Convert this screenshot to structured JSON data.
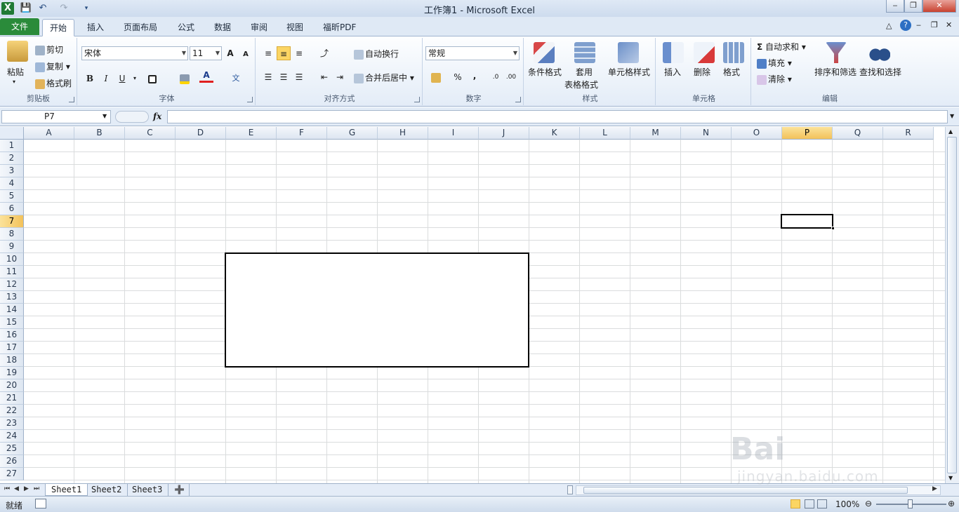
{
  "window": {
    "title": "工作簿1 - Microsoft Excel"
  },
  "qat": {
    "icons": [
      "excel-logo-icon",
      "save-icon",
      "undo-icon",
      "redo-icon",
      "customize-qat-icon"
    ]
  },
  "tabs": [
    "文件",
    "开始",
    "插入",
    "页面布局",
    "公式",
    "数据",
    "审阅",
    "视图",
    "福昕PDF"
  ],
  "ribbon": {
    "clipboard": {
      "paste": "粘贴",
      "cut": "剪切",
      "copy": "复制",
      "format_painter": "格式刷",
      "label": "剪贴板"
    },
    "font": {
      "name": "宋体",
      "size": "11",
      "bold": "B",
      "italic": "I",
      "underline": "U",
      "label": "字体",
      "grow": "A",
      "shrink": "A"
    },
    "alignment": {
      "wrap": "自动换行",
      "merge": "合并后居中",
      "label": "对齐方式"
    },
    "number": {
      "format": "常规",
      "percent": "%",
      "comma": ",",
      "label": "数字"
    },
    "styles": {
      "conditional": "条件格式",
      "table1": "套用",
      "table2": "表格格式",
      "cell_styles": "单元格样式",
      "label": "样式"
    },
    "cells": {
      "insert": "插入",
      "delete": "删除",
      "format": "格式",
      "label": "单元格"
    },
    "editing": {
      "autosum": "自动求和",
      "fill": "填充",
      "clear": "清除",
      "sort": "排序和筛选",
      "find": "查找和选择",
      "label": "编辑"
    }
  },
  "formula": {
    "name_box": "P7",
    "fx": "fx",
    "value": ""
  },
  "grid": {
    "columns": [
      "A",
      "B",
      "C",
      "D",
      "E",
      "F",
      "G",
      "H",
      "I",
      "J",
      "K",
      "L",
      "M",
      "N",
      "O",
      "P",
      "Q",
      "R"
    ],
    "rows": [
      "1",
      "2",
      "3",
      "4",
      "5",
      "6",
      "7",
      "8",
      "9",
      "10",
      "11",
      "12",
      "13",
      "14",
      "15",
      "16",
      "17",
      "18",
      "19",
      "20",
      "21",
      "22",
      "23",
      "24",
      "25",
      "26",
      "27"
    ],
    "selected_column": "P",
    "selected_row": "7"
  },
  "sheets": [
    "Sheet1",
    "Sheet2",
    "Sheet3"
  ],
  "status": {
    "ready": "就绪",
    "zoom": "100%"
  },
  "watermark": {
    "brand": "Bai",
    "site": "jingyan.baidu.com"
  }
}
